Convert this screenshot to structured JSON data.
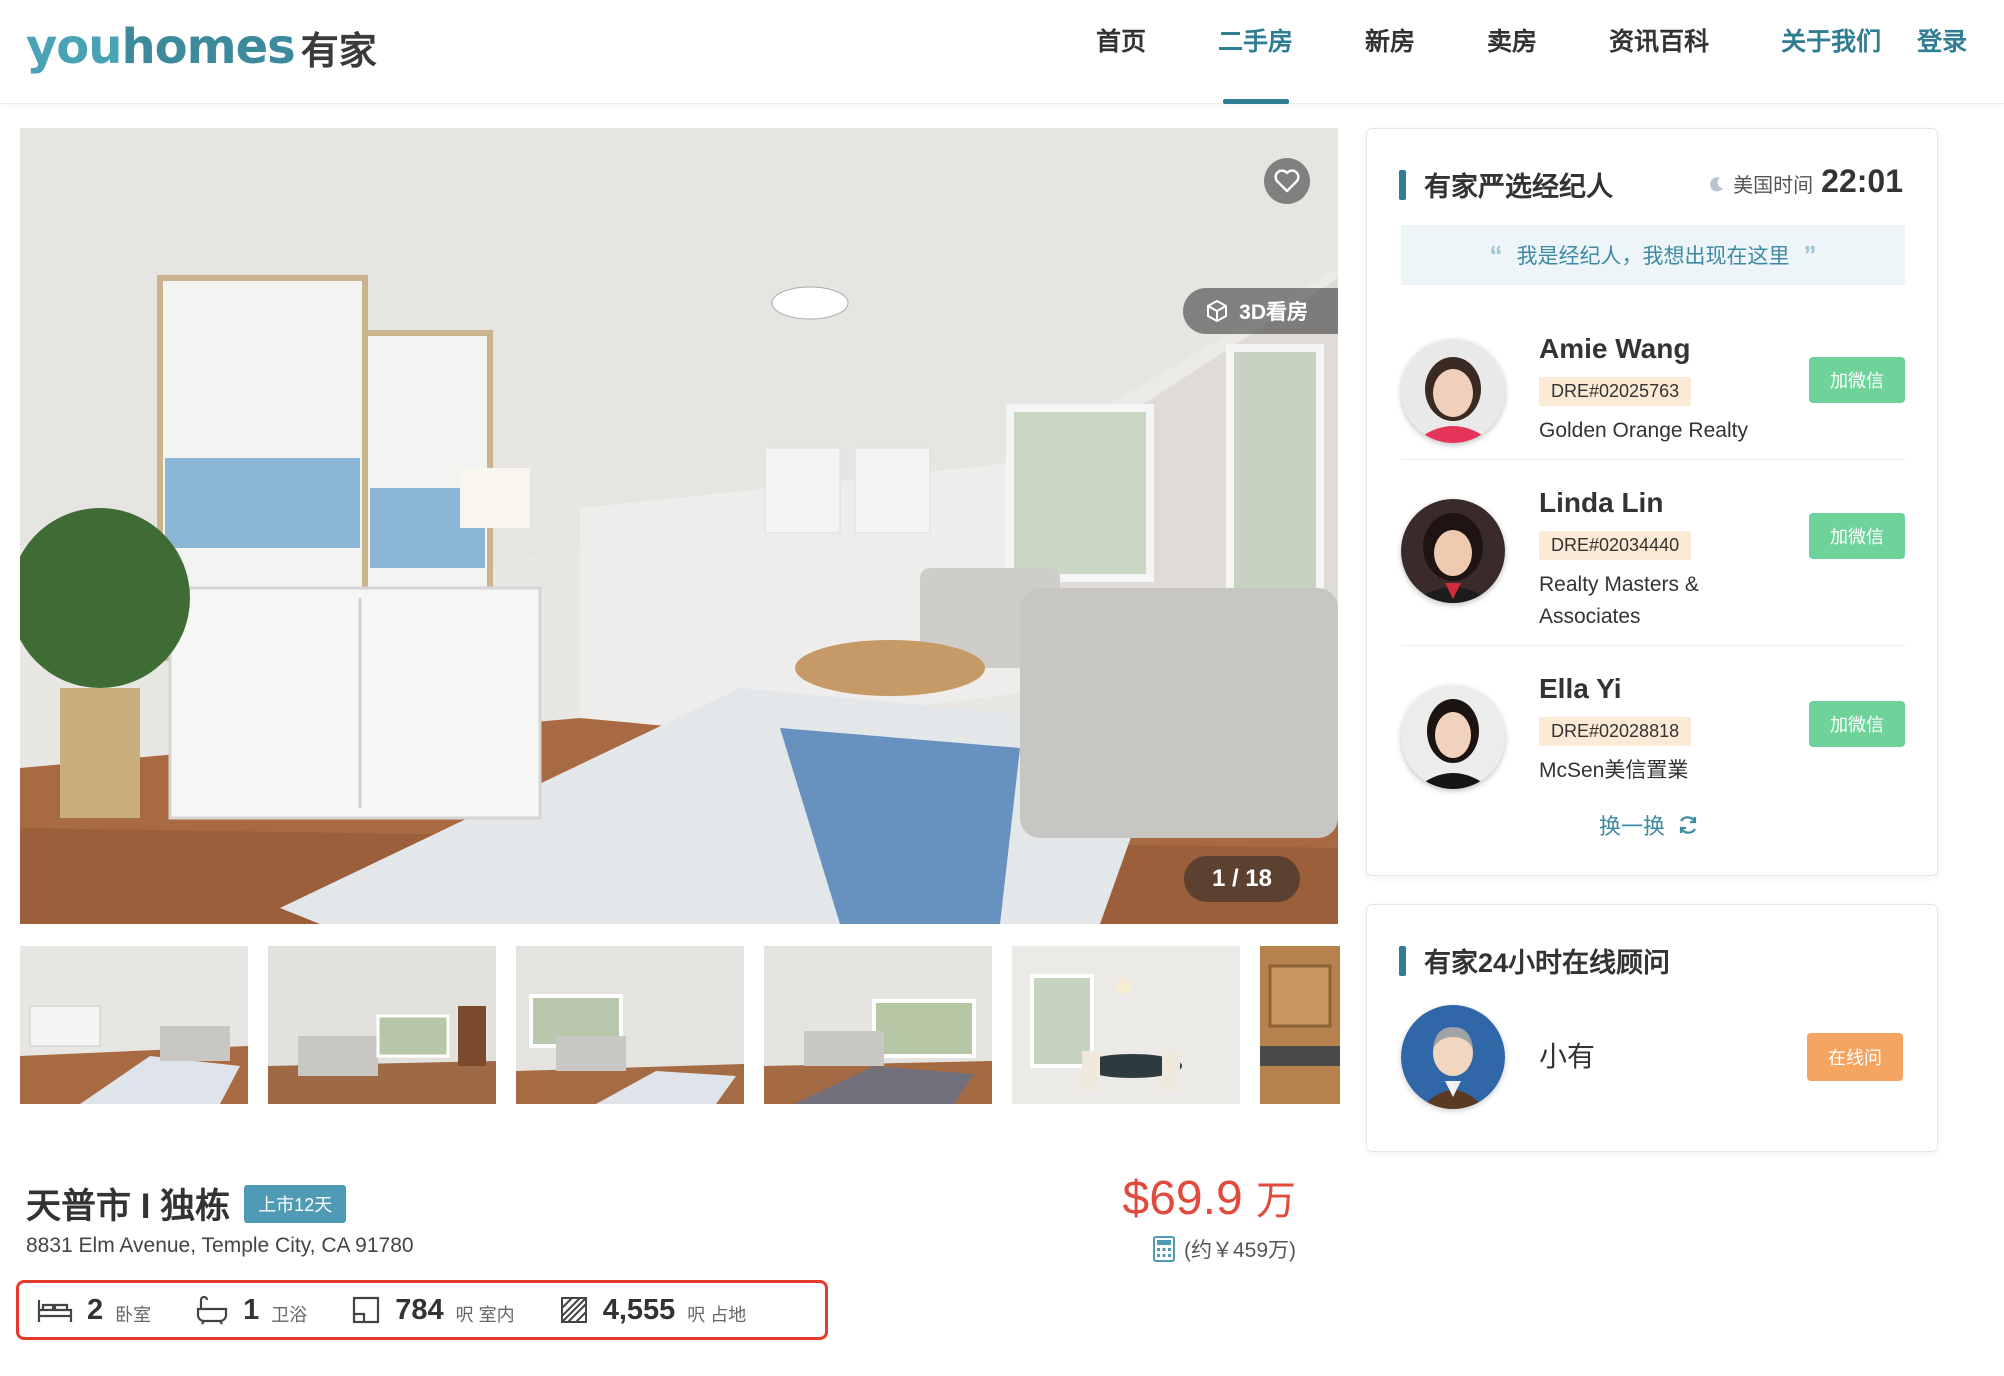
{
  "brand": {
    "logo_en_you": "you",
    "logo_en_homes": "homes",
    "logo_cn": "有家"
  },
  "nav": {
    "items": [
      {
        "label": "首页",
        "active": false
      },
      {
        "label": "二手房",
        "active": true
      },
      {
        "label": "新房",
        "active": false
      },
      {
        "label": "卖房",
        "active": false
      },
      {
        "label": "资讯百科",
        "active": false
      },
      {
        "label": "关于我们",
        "active": false
      },
      {
        "label": "登录",
        "active": false
      }
    ]
  },
  "gallery": {
    "btn_3d_label": "3D看房",
    "counter": "1 / 18",
    "favorite_icon": "heart-icon",
    "thumbnail_count_visible": 6
  },
  "listing": {
    "title": "天普市 I 独栋",
    "days_badge": "上市12天",
    "address": "8831 Elm Avenue, Temple City, CA 91780",
    "price": "$69.9",
    "price_unit": "万",
    "price_rmb": "(约￥459万)",
    "stats": {
      "beds": {
        "value": "2",
        "label": "卧室",
        "icon": "bed-icon"
      },
      "baths": {
        "value": "1",
        "label": "卫浴",
        "icon": "bathtub-icon"
      },
      "interior": {
        "value": "784",
        "label": "呎 室内",
        "icon": "floorplan-icon"
      },
      "lot": {
        "value": "4,555",
        "label": "呎 占地",
        "icon": "lot-icon"
      }
    }
  },
  "agents_card": {
    "title": "有家严选经纪人",
    "us_time_label": "美国时间",
    "us_time": "22:01",
    "want_banner": "我是经纪人，我想出现在这里",
    "agents": [
      {
        "name": "Amie Wang",
        "dre": "DRE#02025763",
        "company": "Golden Orange Realty",
        "btn": "加微信"
      },
      {
        "name": "Linda Lin",
        "dre": "DRE#02034440",
        "company": "Realty Masters & Associates",
        "btn": "加微信"
      },
      {
        "name": "Ella Yi",
        "dre": "DRE#02028818",
        "company": "McSen美信置業",
        "btn": "加微信"
      }
    ],
    "refresh_label": "换一换"
  },
  "advisor_card": {
    "title": "有家24小时在线顾问",
    "name": "小有",
    "btn": "在线问"
  },
  "colors": {
    "brand_teal": "#2f7d93",
    "price_red": "#e14a3c",
    "wechat_green": "#6fd29a",
    "online_orange": "#f5a561",
    "highlight_red_border": "#e53b2c"
  }
}
